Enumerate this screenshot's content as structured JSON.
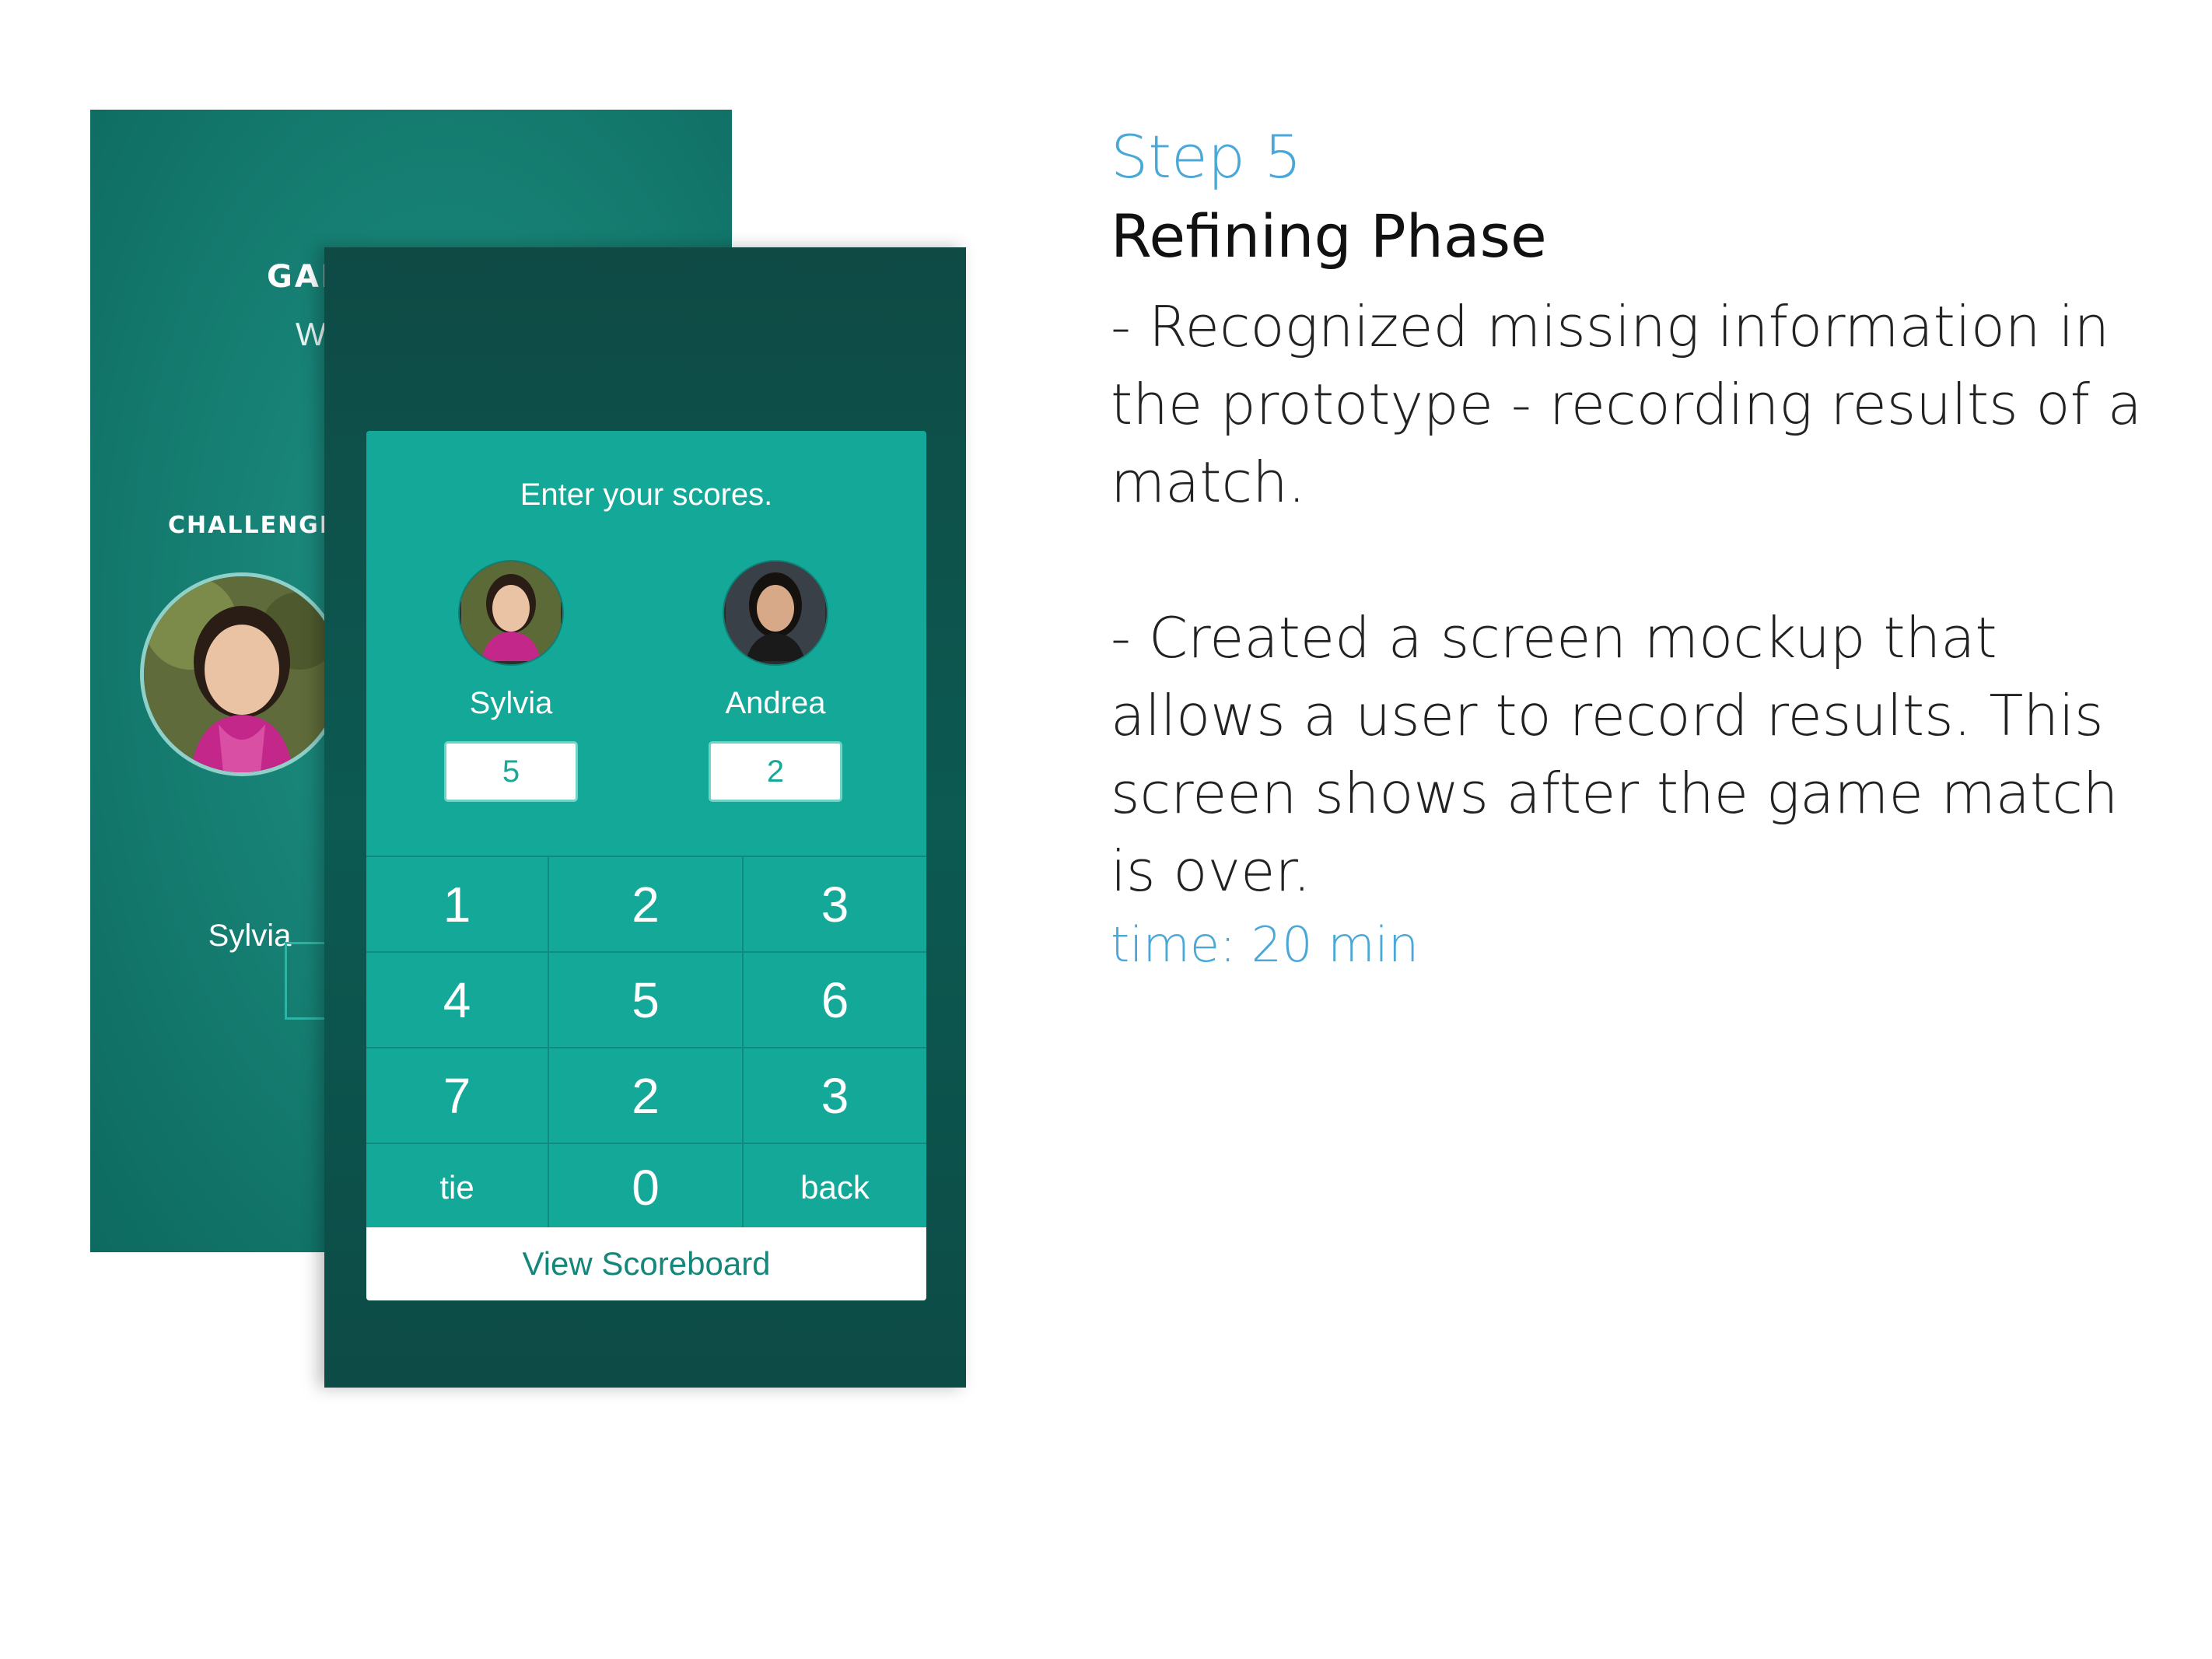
{
  "back_screen": {
    "title_fragment": "GAI",
    "subtitle_fragment": "W",
    "challenger_label": "CHALLENGE",
    "player_name": "Sylvia"
  },
  "score_screen": {
    "prompt": "Enter your scores.",
    "players": [
      {
        "name": "Sylvia",
        "score": "5"
      },
      {
        "name": "Andrea",
        "score": "2"
      }
    ],
    "keypad": [
      [
        "1",
        "2",
        "3"
      ],
      [
        "4",
        "5",
        "6"
      ],
      [
        "7",
        "2",
        "3"
      ],
      [
        "tie",
        "0",
        "back"
      ]
    ],
    "view_scoreboard_label": "View Scoreboard",
    "colors": {
      "card": "#14a898",
      "background": "#0f4a45"
    }
  },
  "description": {
    "step": "Step 5",
    "phase": "Refining Phase",
    "bullets": [
      "- Recognized missing information in the prototype - recording results of a match.",
      "- Created a screen mockup that allows a user to record results. This screen shows after the game match is over."
    ],
    "time": "time: 20 min",
    "accent_color": "#4aa8d8"
  }
}
